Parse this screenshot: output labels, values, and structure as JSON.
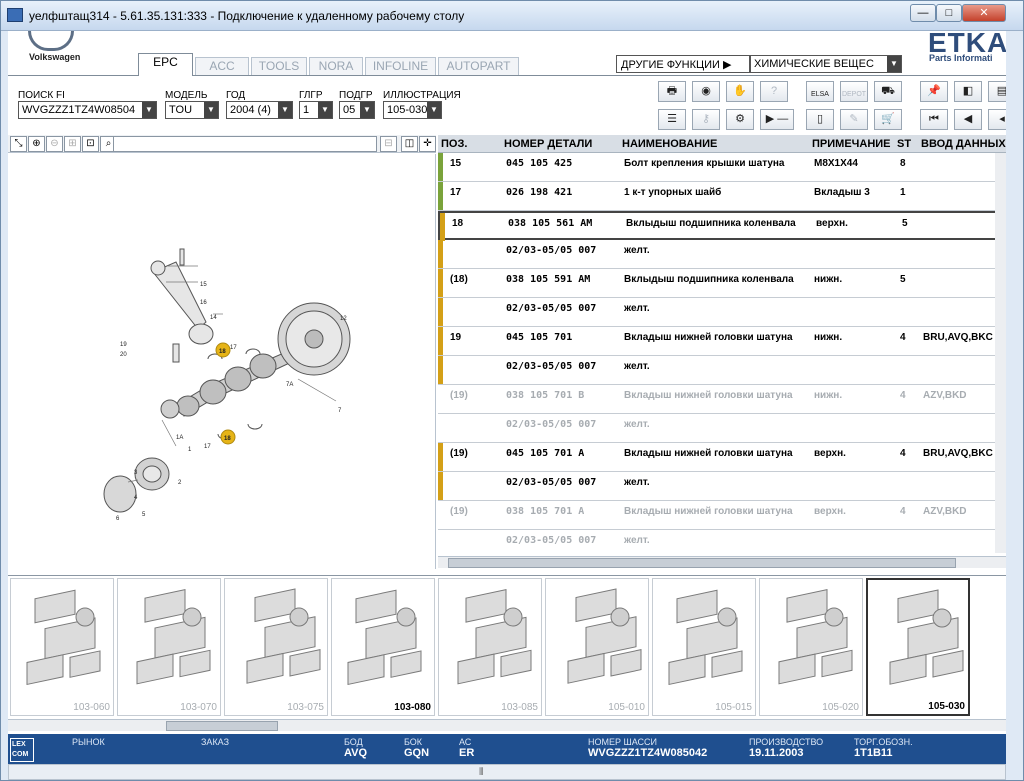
{
  "window": {
    "title": "уелфштащ314 - 5.61.35.131:333 - Подключение к удаленному рабочему столу",
    "min_glyph": "—",
    "max_glyph": "□",
    "close_glyph": "✕"
  },
  "brand": {
    "logo_text": "Volkswagen",
    "etka": "ETKA",
    "etka_sub": "Parts Informati"
  },
  "tabs": [
    "EPC",
    "ACC",
    "TOOLS",
    "NORA",
    "INFOLINE",
    "AUTOPART"
  ],
  "other": {
    "label": "ДРУГИЕ ФУНКЦИИ ▶",
    "value": "ХИМИЧЕСКИЕ ВЕЩЕС"
  },
  "fields": {
    "search_label": "ПОИСК FI",
    "search_value": "WVGZZZ1TZ4W08504",
    "model_label": "МОДЕЛЬ",
    "model_value": "TOU",
    "year_label": "ГОД",
    "year_value": "2004 (4)",
    "glgr_label": "ГЛГР",
    "glgr_value": "1",
    "podgr_label": "ПОДГР",
    "podgr_value": "05",
    "illus_label": "ИЛЛЮСТРАЦИЯ",
    "illus_value": "105-030"
  },
  "toolbar": {
    "elsa": "ELSA",
    "depot": "DEPOT",
    "minus": "▶ —"
  },
  "table": {
    "headers": [
      "ПОЗ.",
      "НОМЕР ДЕТАЛИ",
      "НАИМЕНОВАНИЕ",
      "ПРИМЕЧАНИЕ",
      "ST",
      "ВВОД ДАННЫХ"
    ],
    "rows": [
      {
        "pos": "15",
        "part": "045 105 425",
        "name": "Болт крепления крышки шатуна",
        "note": "M8X1X44",
        "st": "8",
        "data": "",
        "mark": "#7aa33b",
        "dim": false,
        "sel": false
      },
      {
        "pos": "17",
        "part": "026 198 421",
        "name": "1 к-т упорных шайб",
        "note": "Вкладыш 3",
        "st": "1",
        "data": "",
        "mark": "#7aa33b",
        "dim": false,
        "sel": false
      },
      {
        "pos": "18",
        "part": "038 105 561 AM",
        "name": "Вклыдыш подшипника коленвала",
        "note": "верхн.",
        "st": "5",
        "data": "",
        "mark": "#d4a017",
        "dim": false,
        "sel": true
      },
      {
        "pos": "",
        "part": "02/03-05/05 007",
        "name": "желт.",
        "note": "",
        "st": "",
        "data": "",
        "mark": "#d4a017",
        "dim": false,
        "sel": false
      },
      {
        "pos": "(18)",
        "part": "038 105 591 AM",
        "name": "Вклыдыш подшипника коленвала",
        "note": "нижн.",
        "st": "5",
        "data": "",
        "mark": "#d4a017",
        "dim": false,
        "sel": false
      },
      {
        "pos": "",
        "part": "02/03-05/05 007",
        "name": "желт.",
        "note": "",
        "st": "",
        "data": "",
        "mark": "#d4a017",
        "dim": false,
        "sel": false
      },
      {
        "pos": "19",
        "part": "045 105 701",
        "name": "Вкладыш нижней головки шатуна",
        "note": "нижн.",
        "st": "4",
        "data": "BRU,AVQ,BKC",
        "mark": "#d4a017",
        "dim": false,
        "sel": false
      },
      {
        "pos": "",
        "part": "02/03-05/05 007",
        "name": "желт.",
        "note": "",
        "st": "",
        "data": "",
        "mark": "#d4a017",
        "dim": false,
        "sel": false
      },
      {
        "pos": "(19)",
        "part": "038 105 701 B",
        "name": "Вкладыш нижней головки шатуна",
        "note": "нижн.",
        "st": "4",
        "data": "AZV,BKD",
        "mark": "",
        "dim": true,
        "sel": false
      },
      {
        "pos": "",
        "part": "02/03-05/05 007",
        "name": "желт.",
        "note": "",
        "st": "",
        "data": "",
        "mark": "",
        "dim": true,
        "sel": false
      },
      {
        "pos": "(19)",
        "part": "045 105 701 A",
        "name": "Вкладыш нижней головки шатуна",
        "note": "верхн.",
        "st": "4",
        "data": "BRU,AVQ,BKC",
        "mark": "#d4a017",
        "dim": false,
        "sel": false
      },
      {
        "pos": "",
        "part": "02/03-05/05 007",
        "name": "желт.",
        "note": "",
        "st": "",
        "data": "",
        "mark": "#d4a017",
        "dim": false,
        "sel": false
      },
      {
        "pos": "(19)",
        "part": "038 105 701 A",
        "name": "Вкладыш нижней головки шатуна",
        "note": "верхн.",
        "st": "4",
        "data": "AZV,BKD",
        "mark": "",
        "dim": true,
        "sel": false
      },
      {
        "pos": "",
        "part": "02/03-05/05 007",
        "name": "желт.",
        "note": "",
        "st": "",
        "data": "",
        "mark": "",
        "dim": true,
        "sel": false
      }
    ]
  },
  "illustration_callouts": [
    "16",
    "15",
    "14",
    "19",
    "20",
    "18",
    "17",
    "12",
    "7A",
    "7",
    "3",
    "1A",
    "17",
    "18",
    "2",
    "1",
    "4",
    "5",
    "6"
  ],
  "thumbnails": [
    {
      "label": "103-060",
      "bold": false,
      "sel": false
    },
    {
      "label": "103-070",
      "bold": false,
      "sel": false
    },
    {
      "label": "103-075",
      "bold": false,
      "sel": false
    },
    {
      "label": "103-080",
      "bold": true,
      "sel": false
    },
    {
      "label": "103-085",
      "bold": false,
      "sel": false
    },
    {
      "label": "105-010",
      "bold": false,
      "sel": false
    },
    {
      "label": "105-015",
      "bold": false,
      "sel": false
    },
    {
      "label": "105-020",
      "bold": false,
      "sel": false
    },
    {
      "label": "105-030",
      "bold": true,
      "sel": true
    }
  ],
  "status": {
    "lexcom": "LEX COM",
    "market_label": "РЫНОК",
    "market_value": "",
    "order_label": "ЗАКАЗ",
    "order_value": "",
    "bod_label": "БОД",
    "bod_value": "AVQ",
    "bok_label": "БОК",
    "bok_value": "GQN",
    "ac_label": "АС",
    "ac_value": "ER",
    "chassis_label": "НОМЕР ШАССИ",
    "chassis_value": "WVGZZZ1TZ4W085042",
    "prod_label": "ПРОИЗВОДСТВО",
    "prod_value": "19.11.2003",
    "torg_label": "ТОРГ.ОБОЗН.",
    "torg_value": "1T1B11"
  },
  "scroll": {
    "grip": "⦀"
  }
}
